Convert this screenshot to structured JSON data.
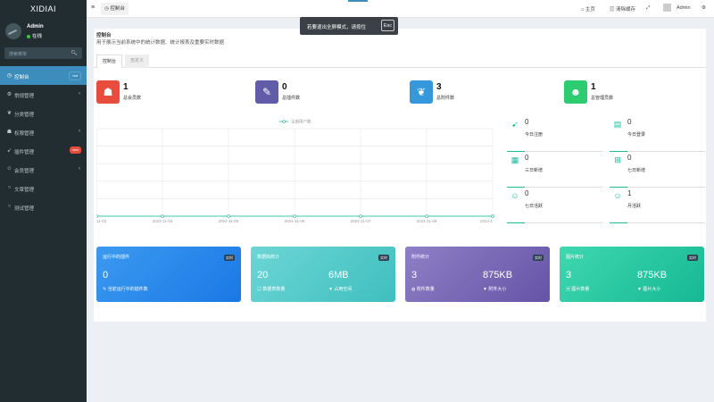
{
  "app": {
    "logo": "XIDIAI"
  },
  "user": {
    "name": "Admin",
    "status": "在线"
  },
  "sidebar": {
    "search_placeholder": "搜索菜单",
    "items": [
      {
        "label": "控制台",
        "icon": "dashboard-icon",
        "badge": "hot"
      },
      {
        "label": "常规管理",
        "icon": "cogs-icon"
      },
      {
        "label": "分类管理",
        "icon": "leaf-icon"
      },
      {
        "label": "权限管理",
        "icon": "group-icon"
      },
      {
        "label": "插件管理",
        "icon": "rocket-icon",
        "badge": "new"
      },
      {
        "label": "会员管理",
        "icon": "user-circle-icon"
      },
      {
        "label": "文章管理",
        "icon": "circle-o-icon"
      },
      {
        "label": "测试管理",
        "icon": "circle-o-icon"
      }
    ]
  },
  "topbar": {
    "tab_label": "控制台",
    "home": "主页",
    "clear_cache": "清除缓存",
    "user": "Admin"
  },
  "toast": {
    "text": "若要退出全屏模式，请按住",
    "key": "Esc"
  },
  "panel": {
    "title": "控制台",
    "description": "用于展示当前系统中的统计数据、统计报表及重要实时数据",
    "tabs": [
      "控制台",
      "自定义"
    ]
  },
  "stats": [
    {
      "value": "1",
      "label": "总会员数",
      "color": "#e74c3c",
      "icon": "users-icon"
    },
    {
      "value": "0",
      "label": "总插件数",
      "color": "#605ca8",
      "icon": "magic-icon"
    },
    {
      "value": "3",
      "label": "总附件数",
      "color": "#3498db",
      "icon": "leaf-icon"
    },
    {
      "value": "1",
      "label": "总管理员数",
      "color": "#2ecc71",
      "icon": "user-icon"
    }
  ],
  "chart_data": {
    "type": "line",
    "legend": [
      "注册用户数"
    ],
    "categories": [
      "11-03",
      "2024-11-04",
      "2024-11-05",
      "2024-11-06",
      "2024-11-07",
      "2024-11-08",
      "2024-1"
    ],
    "series": [
      {
        "name": "注册用户数",
        "values": [
          0,
          0,
          0,
          0,
          0,
          0,
          0
        ]
      }
    ],
    "grid": true,
    "legend_position": "top"
  },
  "mini_stats": [
    {
      "value": "0",
      "label": "今日注册",
      "icon": "rocket-icon"
    },
    {
      "value": "0",
      "label": "今日登录",
      "icon": "vcard-icon"
    },
    {
      "value": "0",
      "label": "三日新增",
      "icon": "calendar-icon"
    },
    {
      "value": "0",
      "label": "七日新增",
      "icon": "calendar-plus-icon"
    },
    {
      "value": "0",
      "label": "七日活跃",
      "icon": "user-circle-icon"
    },
    {
      "value": "1",
      "label": "月活跃",
      "icon": "user-circle-icon"
    }
  ],
  "cards": [
    {
      "title": "运行中的插件",
      "badge": "实时",
      "color_from": "#3c9af0",
      "color_to": "#1a78e6",
      "values": [
        {
          "v": "0",
          "l": "当前运行中的插件数",
          "i": "✎"
        }
      ]
    },
    {
      "title": "数据库统计",
      "badge": "实时",
      "color_from": "#6dd5d5",
      "color_to": "#3fbfbf",
      "values": [
        {
          "v": "20",
          "l": "数据表数量",
          "i": "▤"
        },
        {
          "v": "6MB",
          "l": "占用空间",
          "i": "▼"
        }
      ]
    },
    {
      "title": "附件统计",
      "badge": "实时",
      "color_from": "#8e7fc6",
      "color_to": "#6554a6",
      "values": [
        {
          "v": "3",
          "l": "附件数量",
          "i": "◍"
        },
        {
          "v": "875KB",
          "l": "附件大小",
          "i": "▼"
        }
      ]
    },
    {
      "title": "图片统计",
      "badge": "实时",
      "color_from": "#3ed8b0",
      "color_to": "#16b894",
      "values": [
        {
          "v": "3",
          "l": "图片数量",
          "i": "▣"
        },
        {
          "v": "875KB",
          "l": "图片大小",
          "i": "▼"
        }
      ]
    }
  ]
}
